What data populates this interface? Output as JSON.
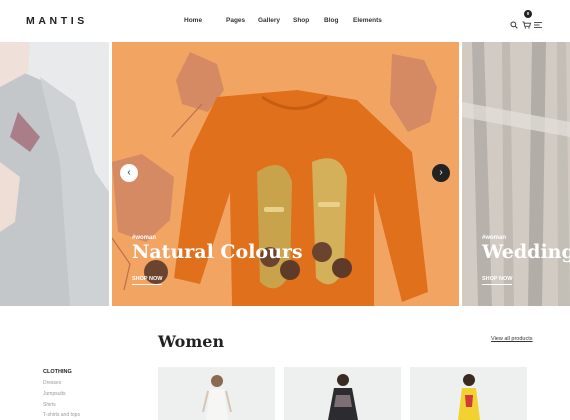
{
  "brand": {
    "logo": "MANTIS"
  },
  "nav": {
    "items": [
      "Home",
      "Pages",
      "Gallery",
      "Shop",
      "Blog",
      "Elements"
    ]
  },
  "header": {
    "cart_count": "0"
  },
  "icons": {
    "search": "search-icon",
    "cart": "cart-icon",
    "menu": "menu-icon",
    "prev": "chevron-left-icon",
    "next": "chevron-right-icon"
  },
  "slider": {
    "center": {
      "tag": "#woman",
      "title": "Natural Colours",
      "cta": "SHOP NOW"
    },
    "right": {
      "tag": "#woman",
      "title": "Wedding C",
      "cta": "SHOP NOW"
    },
    "prev_glyph": "‹",
    "next_glyph": "›"
  },
  "section": {
    "title": "Women",
    "view_all": "View all products"
  },
  "categories": {
    "title": "Clothing",
    "items": [
      "Dresses",
      "Jumpsuits",
      "Shirts",
      "T-shirts and tops"
    ]
  },
  "colors": {
    "accent_orange": "#f2a563",
    "sweater": "#e0701c",
    "dark": "#222222"
  }
}
